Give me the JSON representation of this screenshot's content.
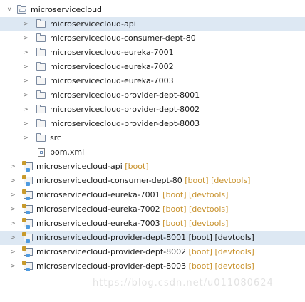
{
  "window": {
    "panel": "Project Explorer"
  },
  "tree": {
    "root": {
      "label": "microservicecloud",
      "expanded": true,
      "icon": "open-folder-icon"
    },
    "children": [
      {
        "label": "microservicecloud-api",
        "icon": "folder-icon"
      },
      {
        "label": "microservicecloud-consumer-dept-80",
        "icon": "folder-icon"
      },
      {
        "label": "microservicecloud-eureka-7001",
        "icon": "folder-icon"
      },
      {
        "label": "microservicecloud-eureka-7002",
        "icon": "folder-icon"
      },
      {
        "label": "microservicecloud-eureka-7003",
        "icon": "folder-icon"
      },
      {
        "label": "microservicecloud-provider-dept-8001",
        "icon": "folder-icon"
      },
      {
        "label": "microservicecloud-provider-dept-8002",
        "icon": "folder-icon"
      },
      {
        "label": "microservicecloud-provider-dept-8003",
        "icon": "folder-icon"
      },
      {
        "label": "src",
        "icon": "folder-icon"
      },
      {
        "label": "pom.xml",
        "icon": "xml-file-icon"
      }
    ],
    "projects": [
      {
        "label": "microservicecloud-api",
        "tags": "[boot]"
      },
      {
        "label": "microservicecloud-consumer-dept-80",
        "tags": "[boot] [devtools]"
      },
      {
        "label": "microservicecloud-eureka-7001",
        "tags": "[boot] [devtools]"
      },
      {
        "label": "microservicecloud-eureka-7002",
        "tags": "[boot] [devtools]"
      },
      {
        "label": "microservicecloud-eureka-7003",
        "tags": "[boot] [devtools]"
      },
      {
        "label": "microservicecloud-provider-dept-8001",
        "tags": "[boot] [devtools]",
        "selected": true
      },
      {
        "label": "microservicecloud-provider-dept-8002",
        "tags": "[boot] [devtools]"
      },
      {
        "label": "microservicecloud-provider-dept-8003",
        "tags": "[boot] [devtools]"
      }
    ]
  },
  "watermark": "https://blog.csdn.net/u011080624",
  "colors": {
    "selection": "#dde8f3",
    "decoration": "#c8922d",
    "text": "#1a1a1a"
  }
}
